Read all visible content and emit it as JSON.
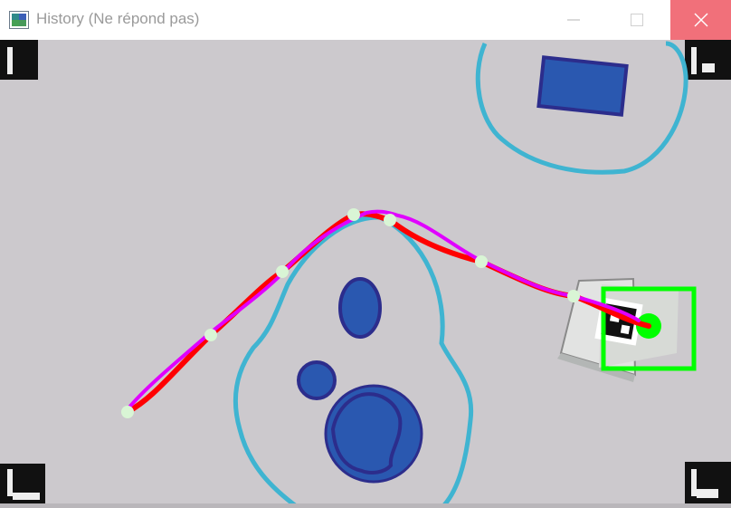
{
  "window": {
    "title": "History (Ne répond pas)",
    "icon": "app-window-icon",
    "controls": {
      "minimize_icon": "minimize-icon",
      "maximize_icon": "maximize-icon",
      "close_icon": "close-icon",
      "close_bg": "#f1707a"
    }
  },
  "view": {
    "background": "#ccc9cd",
    "colors": {
      "zone_outline": "#3fb4d1",
      "obstacle_fill": "#2a58b0",
      "obstacle_edge": "#2c2d8c",
      "path_planned": "#ff0000",
      "path_actual": "#e000ff",
      "waypoint": "#d9f5d5",
      "robot_box": "#00ff00",
      "corner_marker": "#111111"
    },
    "icons": [
      "corner-marker-icon",
      "aruco-marker-icon",
      "robot-target-icon"
    ]
  }
}
